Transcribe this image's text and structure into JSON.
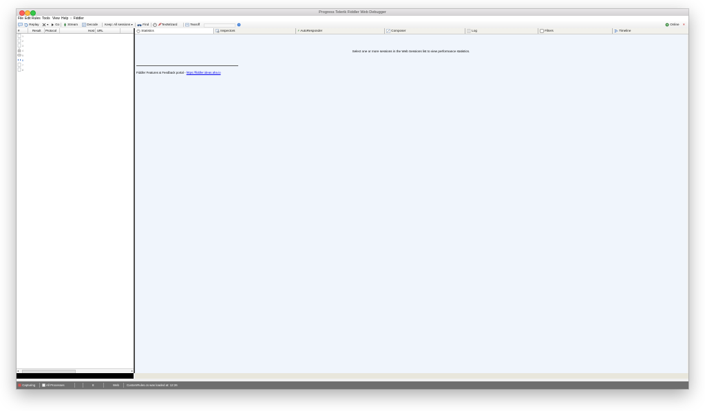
{
  "window": {
    "title": "Progress Telerik Fiddler Web Debugger"
  },
  "menu": [
    "File",
    "Edit",
    "Rules",
    "Tools",
    "View",
    "Help",
    "⁙ Fiddler"
  ],
  "toolbar": {
    "replay": "Replay",
    "go": "Go",
    "stream": "Stream",
    "decode": "Decode",
    "keep": "Keep: All sessions",
    "find": "Find",
    "textwizard": "TextWizard",
    "tearoff": "Tearoff",
    "online": "Online"
  },
  "session_list": {
    "columns": [
      "#",
      "Result",
      "Protocol",
      "Host",
      "URL"
    ],
    "rows": [
      "1",
      "2",
      "3",
      "4",
      "5",
      "6",
      "7",
      "8"
    ]
  },
  "tabs": [
    "Statistics",
    "Inspectors",
    "AutoResponder",
    "Composer",
    "Log",
    "Filters",
    "Timeline"
  ],
  "statistics": {
    "message": "Select one or more sessions in the Web Sessions list to view performance statistics.",
    "feedback_prefix": "Fiddler Features & Feedback portal - ",
    "feedback_link": "https://fiddler.ideas.aha.io"
  },
  "status": {
    "capturing": "Capturing",
    "processes": "All Processes",
    "count": "8",
    "web": "Web",
    "message": "CustomRules.cs was loaded at: 12:26"
  },
  "colors": {
    "accent_link": "#0000ee",
    "content_bg": "#f0f5fc",
    "statusbar_bg": "#6e6e6e",
    "close_red": "#fc605b",
    "min_yellow": "#fdbc40",
    "max_green": "#34c84a"
  }
}
